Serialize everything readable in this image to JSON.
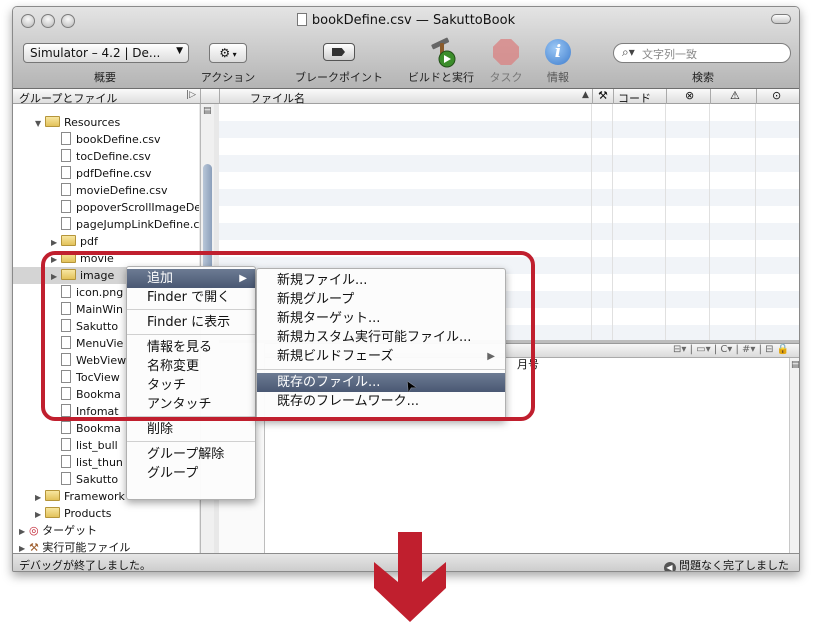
{
  "window": {
    "title": "bookDefine.csv — SakuttoBook"
  },
  "toolbar": {
    "scheme_value": "Simulator – 4.2 | De...",
    "scheme_label": "概要",
    "action_label": "アクション",
    "breakpoints_label": "ブレークポイント",
    "build_run_label": "ビルドと実行",
    "tasks_label": "タスク",
    "info_label": "情報",
    "search_placeholder": "文字列一致",
    "search_label": "検索"
  },
  "sidebar": {
    "header": "グループとファイル",
    "items": [
      {
        "label": "Resources",
        "type": "folder",
        "indent": 1,
        "expanded": true
      },
      {
        "label": "bookDefine.csv",
        "type": "file",
        "indent": 2
      },
      {
        "label": "tocDefine.csv",
        "type": "file",
        "indent": 2
      },
      {
        "label": "pdfDefine.csv",
        "type": "file",
        "indent": 2
      },
      {
        "label": "movieDefine.csv",
        "type": "file",
        "indent": 2
      },
      {
        "label": "popoverScrollImageDe",
        "type": "file",
        "indent": 2
      },
      {
        "label": "pageJumpLinkDefine.c",
        "type": "file",
        "indent": 2
      },
      {
        "label": "pdf",
        "type": "folder",
        "indent": 2
      },
      {
        "label": "movie",
        "type": "folder",
        "indent": 2
      },
      {
        "label": "image",
        "type": "folder",
        "indent": 2,
        "selected": true
      },
      {
        "label": "icon.png",
        "type": "file",
        "indent": 2
      },
      {
        "label": "MainWin",
        "type": "file",
        "indent": 2
      },
      {
        "label": "Sakutto",
        "type": "file",
        "indent": 2
      },
      {
        "label": "MenuVie",
        "type": "file",
        "indent": 2
      },
      {
        "label": "WebView",
        "type": "file",
        "indent": 2
      },
      {
        "label": "TocView",
        "type": "file",
        "indent": 2
      },
      {
        "label": "Bookma",
        "type": "file",
        "indent": 2
      },
      {
        "label": "Infomat",
        "type": "file",
        "indent": 2
      },
      {
        "label": "Bookma",
        "type": "file",
        "indent": 2
      },
      {
        "label": "list_bull",
        "type": "file",
        "indent": 2
      },
      {
        "label": "list_thun",
        "type": "file",
        "indent": 2
      },
      {
        "label": "Sakutto",
        "type": "file",
        "indent": 2
      },
      {
        "label": "Framework",
        "type": "folder",
        "indent": 1
      },
      {
        "label": "Products",
        "type": "folder",
        "indent": 1
      },
      {
        "label": "ターゲット",
        "type": "target",
        "indent": 0
      },
      {
        "label": "実行可能ファイル",
        "type": "exec",
        "indent": 0
      }
    ]
  },
  "file_list": {
    "col_filename": "ファイル名",
    "col_code": "コード"
  },
  "editor": {
    "partial_text": "月号"
  },
  "context_menu": {
    "items": [
      {
        "label": "追加",
        "has_submenu": true,
        "highlighted": true
      },
      {
        "label": "Finder で開く"
      },
      {
        "separator": true
      },
      {
        "label": "Finder に表示"
      },
      {
        "separator": true
      },
      {
        "label": "情報を見る"
      },
      {
        "label": "名称変更"
      },
      {
        "label": "タッチ"
      },
      {
        "label": "アンタッチ"
      },
      {
        "separator": true
      },
      {
        "label": "削除"
      },
      {
        "separator": true
      },
      {
        "label": "グループ解除"
      },
      {
        "label": "グループ"
      }
    ]
  },
  "submenu": {
    "items": [
      {
        "label": "新規ファイル..."
      },
      {
        "label": "新規グループ"
      },
      {
        "label": "新規ターゲット..."
      },
      {
        "label": "新規カスタム実行可能ファイル..."
      },
      {
        "label": "新規ビルドフェーズ",
        "has_submenu": true
      },
      {
        "separator": true
      },
      {
        "label": "既存のファイル...",
        "highlighted": true
      },
      {
        "label": "既存のフレームワーク..."
      }
    ]
  },
  "status": {
    "left": "デバッグが終了しました。",
    "right": "問題なく完了しました"
  },
  "colors": {
    "highlight_frame": "#c01f2e",
    "menu_highlight": "#55637c"
  }
}
